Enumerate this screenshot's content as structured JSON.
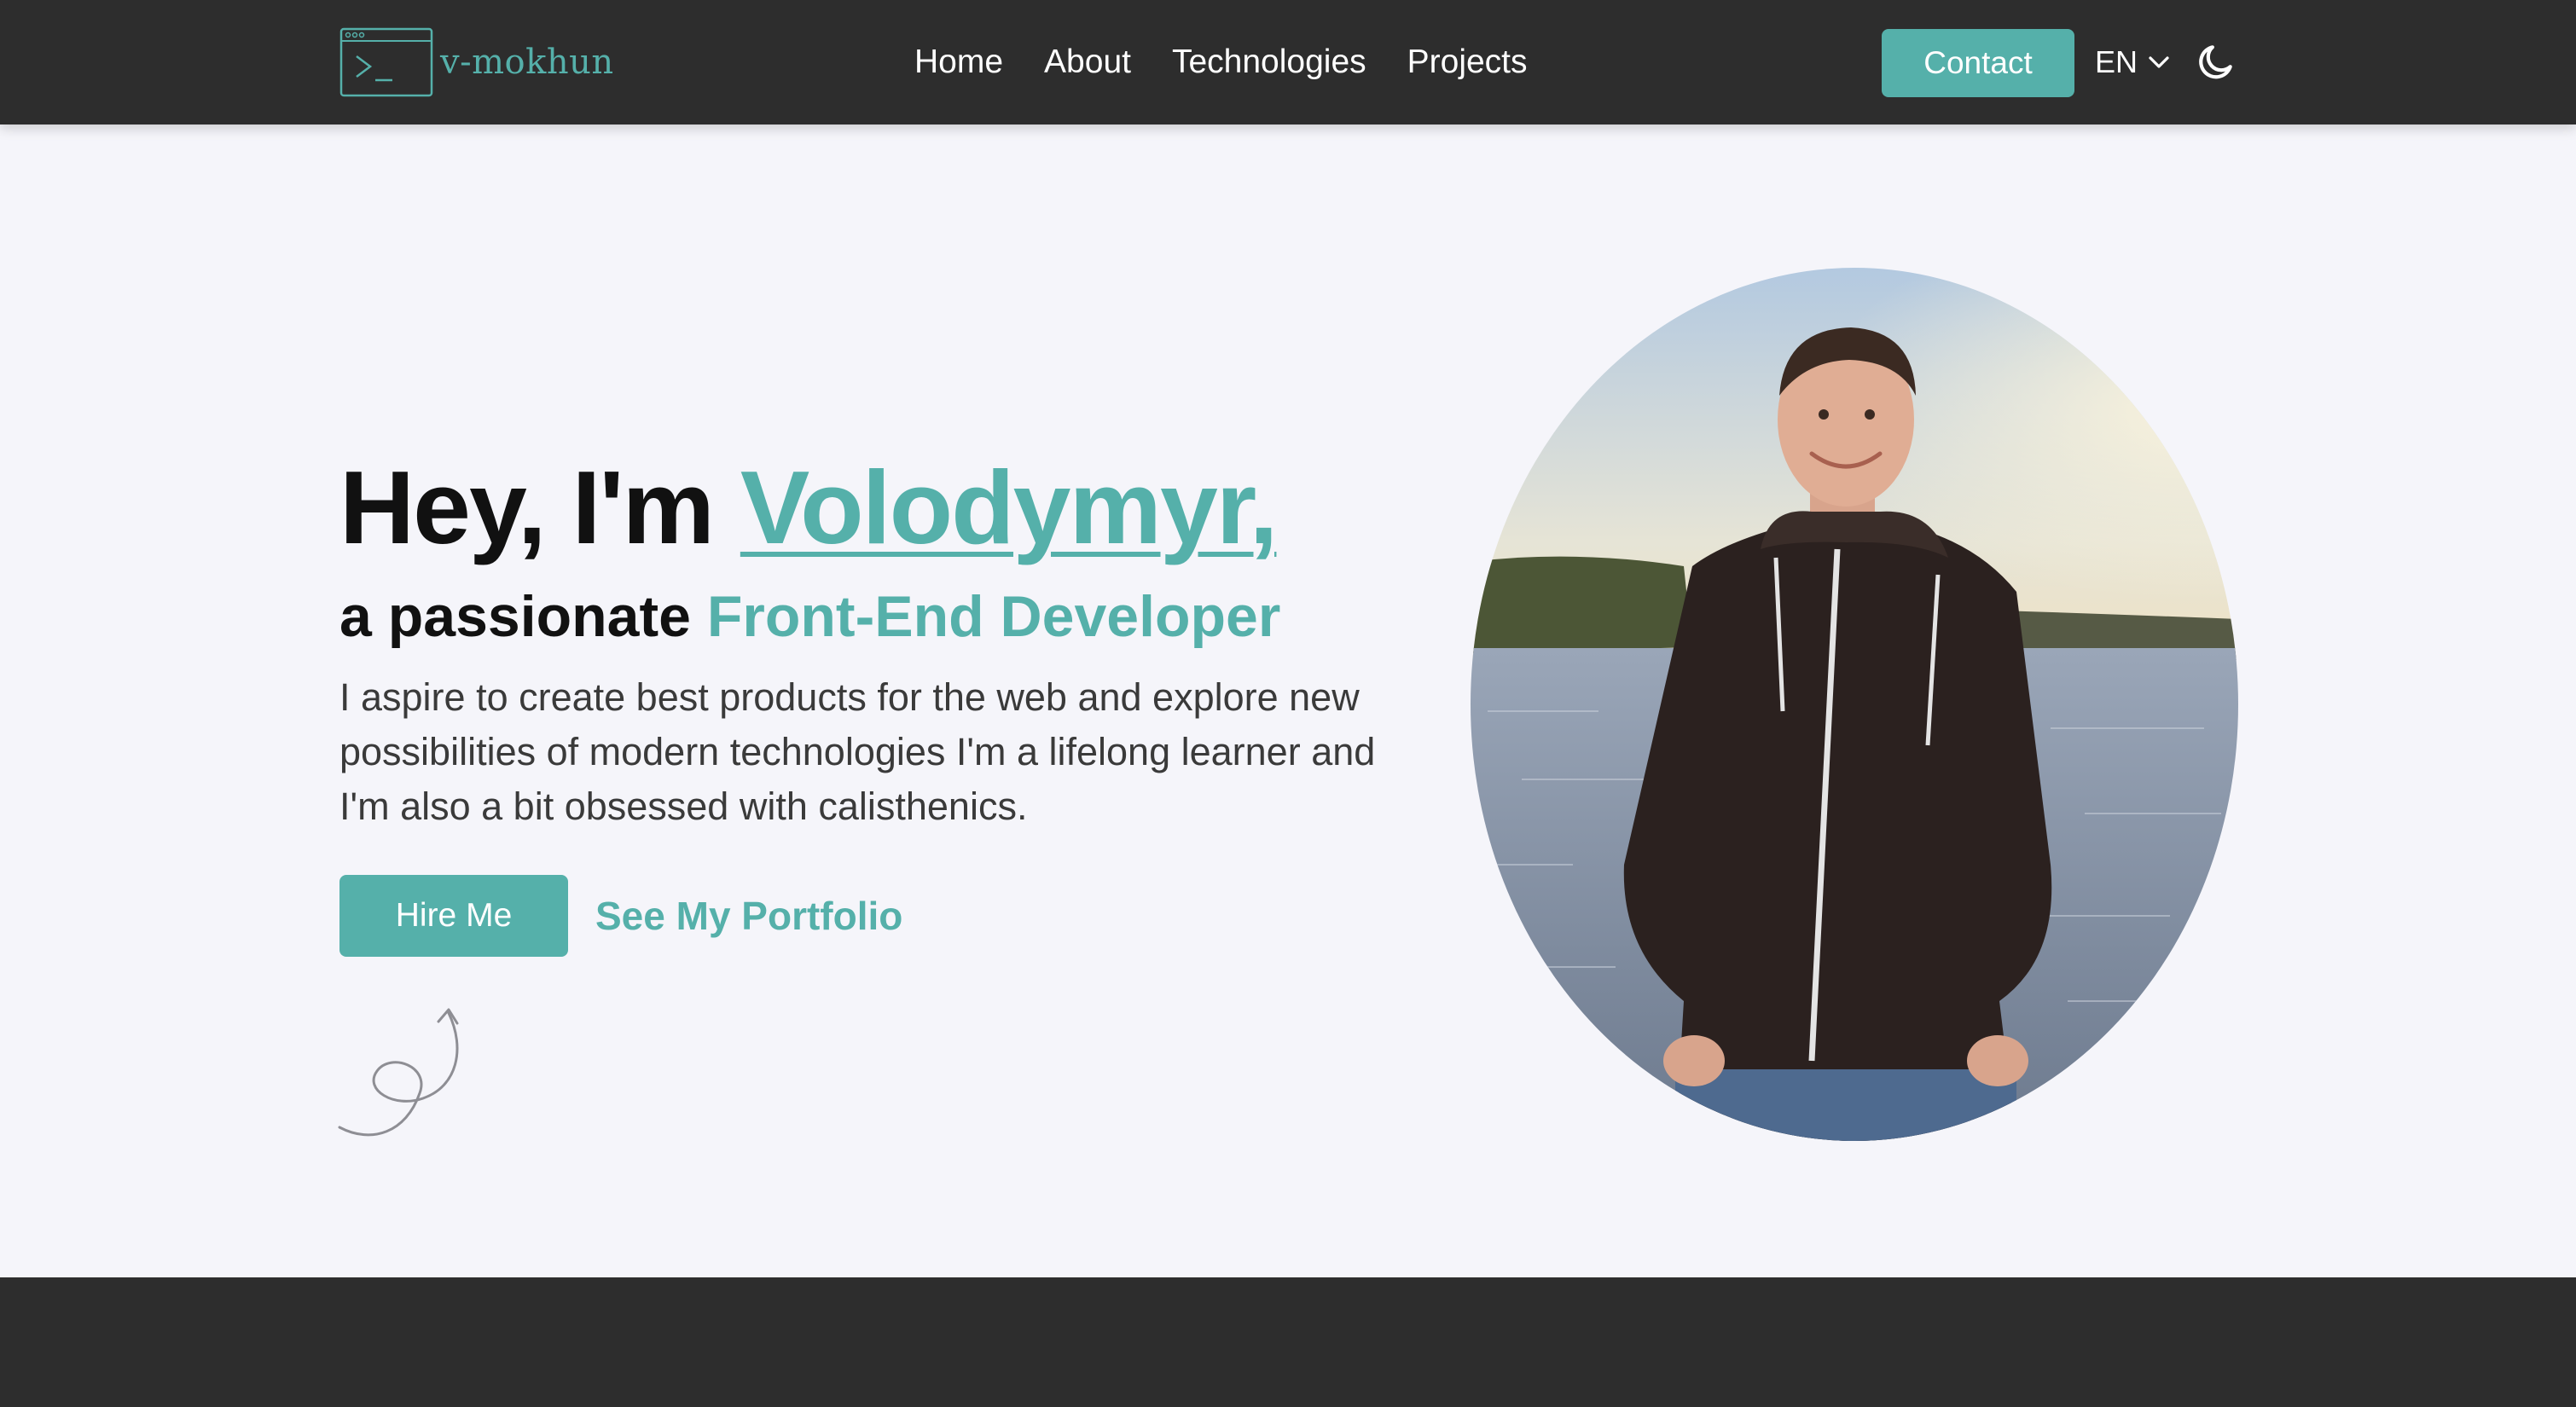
{
  "header": {
    "logo_text": "v-mokhun",
    "nav": [
      {
        "label": "Home"
      },
      {
        "label": "About"
      },
      {
        "label": "Technologies"
      },
      {
        "label": "Projects"
      }
    ],
    "contact_label": "Contact",
    "language": "EN",
    "theme_icon": "moon-icon"
  },
  "hero": {
    "greeting": "Hey, I'm ",
    "name": "Volodymyr,",
    "sub_prefix": "a passionate ",
    "sub_role": "Front-End Developer",
    "description": "I aspire to create best products for the web and explore new possibilities of modern technologies I'm a lifelong learner and I'm also a bit obsessed with calisthenics.",
    "hire_label": "Hire Me",
    "portfolio_label": "See My Portfolio"
  },
  "colors": {
    "accent": "#55b0aa",
    "header_bg": "#2d2d2d",
    "page_bg": "#f5f5fa"
  }
}
